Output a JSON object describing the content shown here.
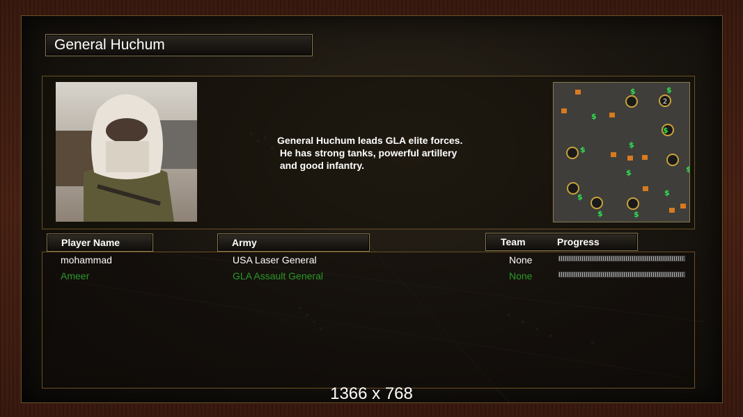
{
  "general": {
    "name": "General Huchum",
    "description": [
      "General Huchum leads GLA elite forces.",
      " He has strong tanks, powerful artillery",
      " and good infantry."
    ]
  },
  "minimap": {
    "player_marker": "2",
    "resource_symbol": "$"
  },
  "columns": {
    "player_name": "Player Name",
    "army": "Army",
    "team": "Team",
    "progress": "Progress"
  },
  "players": [
    {
      "name": "mohammad",
      "army": "USA Laser General",
      "team": "None",
      "progress": 1.0,
      "color": "#ffffff"
    },
    {
      "name": "Ameer",
      "army": "GLA Assault General",
      "team": "None",
      "progress": 1.0,
      "color": "#2a9a2a"
    }
  ],
  "resolution_label": "1366 x 768"
}
